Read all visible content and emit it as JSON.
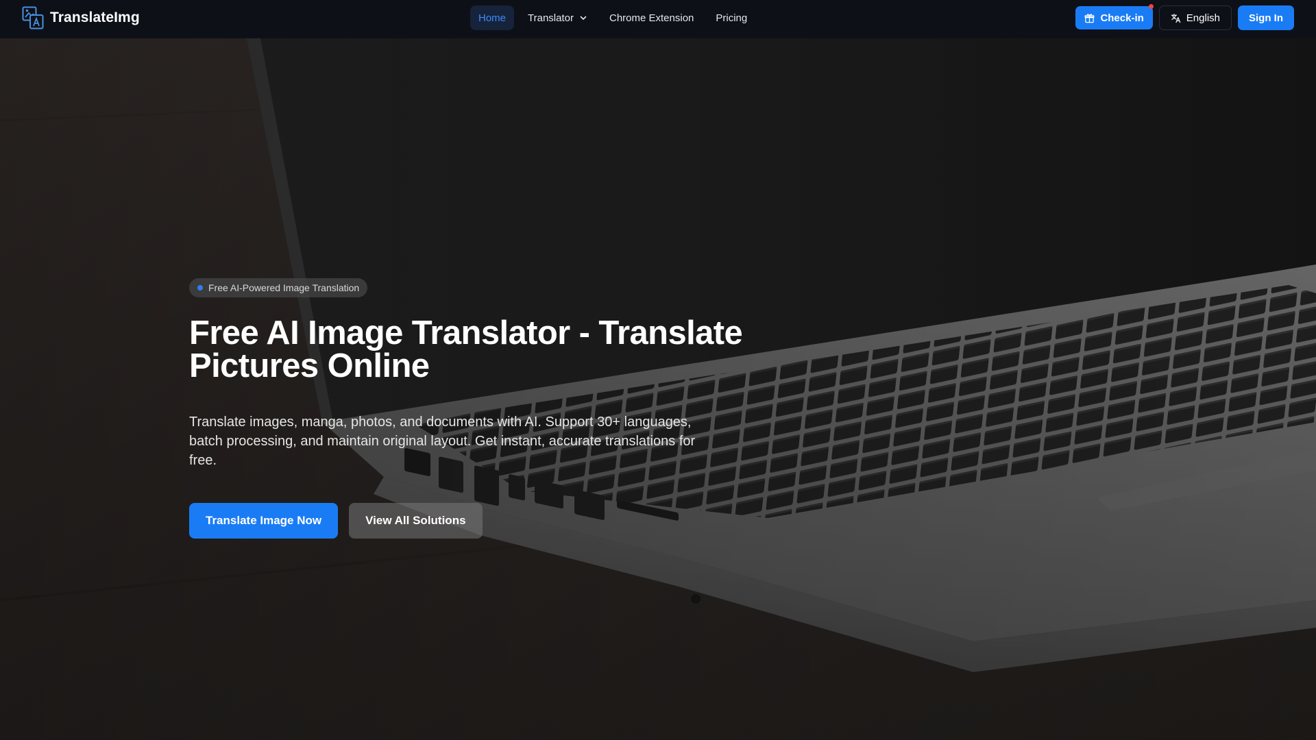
{
  "navbar": {
    "brand_name": "TranslateImg",
    "links": [
      {
        "label": "Home",
        "active": true
      },
      {
        "label": "Translator",
        "active": false,
        "has_dropdown": true
      },
      {
        "label": "Chrome Extension",
        "active": false
      },
      {
        "label": "Pricing",
        "active": false
      }
    ],
    "checkin_label": "Check-in",
    "language_label": "English",
    "signin_label": "Sign In"
  },
  "hero": {
    "badge_label": "Free AI-Powered Image Translation",
    "title": "Free AI Image Translator - Translate Pictures Online",
    "subtitle": "Translate images, manga, photos, and documents with AI. Support 30+ languages, batch processing, and maintain original layout. Get instant, accurate translations for free.",
    "primary_cta": "Translate Image Now",
    "secondary_cta": "View All Solutions"
  },
  "icons": {
    "logo": "translate-image-logo-icon",
    "dropdown": "chevron-down-icon",
    "checkin": "gift-icon",
    "language": "translate-icon",
    "badge_dot": "status-dot-icon"
  },
  "colors": {
    "accent": "#1a7cf5",
    "navbar_bg": "#0d1117",
    "active_link": "#3b8cff",
    "notify": "#ef4444"
  }
}
